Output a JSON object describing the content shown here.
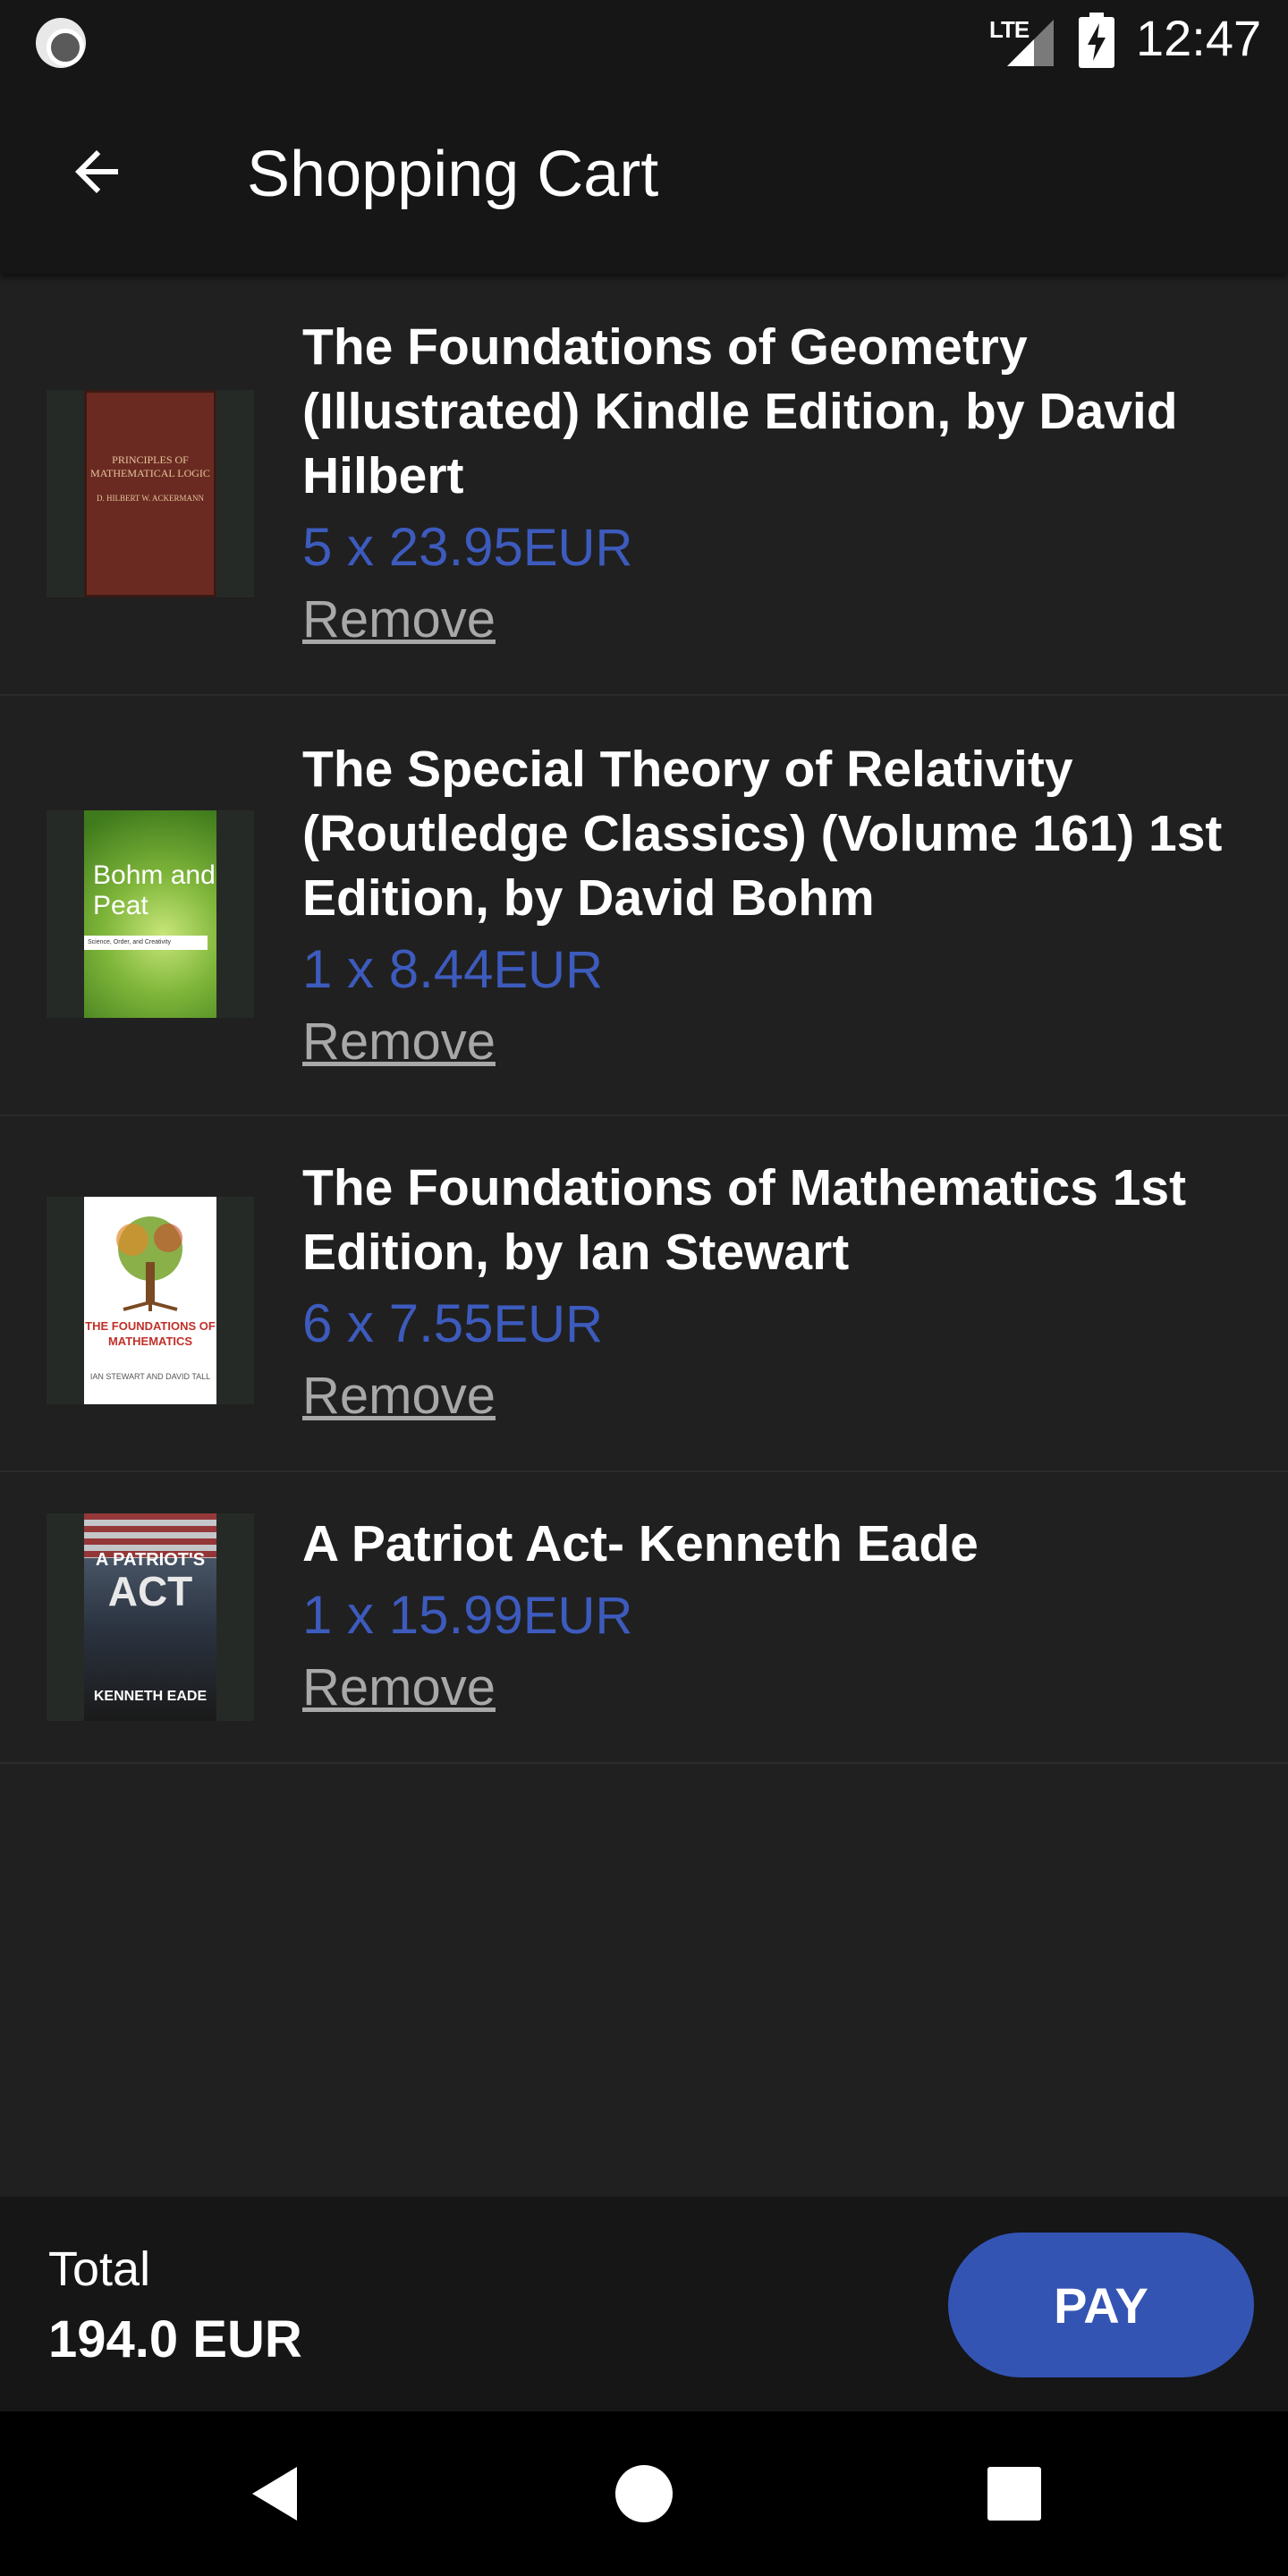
{
  "status_bar": {
    "network": "LTE",
    "time": "12:47"
  },
  "app_bar": {
    "title": "Shopping Cart",
    "back_icon": "arrow-back-icon"
  },
  "cart": {
    "items": [
      {
        "title": "The Foundations of Geometry (Illustrated) Kindle Edition, by David Hilbert",
        "quantity": "5 x ",
        "unit_price": "23.95",
        "currency": "EUR",
        "remove_label": "Remove",
        "cover": {
          "title": "PRINCIPLES OF MATHEMATICAL LOGIC",
          "authors": "D. HILBERT W. ACKERMANN"
        }
      },
      {
        "title": "The Special Theory of Relativity (Routledge Classics) (Volume 161) 1st Edition, by David Bohm",
        "quantity": "1 x ",
        "unit_price": "8.44",
        "currency": "EUR",
        "remove_label": "Remove",
        "cover": {
          "title": "Bohm and Peat",
          "subtitle": "Science, Order, and Creativity"
        }
      },
      {
        "title": "The Foundations of Mathematics 1st Edition, by Ian Stewart",
        "quantity": "6 x ",
        "unit_price": "7.55",
        "currency": "EUR",
        "remove_label": "Remove",
        "cover": {
          "title": "THE FOUNDATIONS OF MATHEMATICS",
          "authors": "IAN STEWART AND DAVID TALL"
        }
      },
      {
        "title": "A Patriot Act- Kenneth Eade",
        "quantity": "1 x ",
        "unit_price": "15.99",
        "currency": "EUR",
        "remove_label": "Remove",
        "cover": {
          "title_top": "A PATRIOT'S",
          "title_main": "ACT",
          "author": "KENNETH EADE"
        }
      }
    ]
  },
  "total_bar": {
    "label": "Total",
    "value": "194.0 EUR",
    "pay_label": "PAY"
  },
  "colors": {
    "background": "#202020",
    "bars": "#161616",
    "accent": "#3454b4",
    "price": "#3d5bbd"
  }
}
